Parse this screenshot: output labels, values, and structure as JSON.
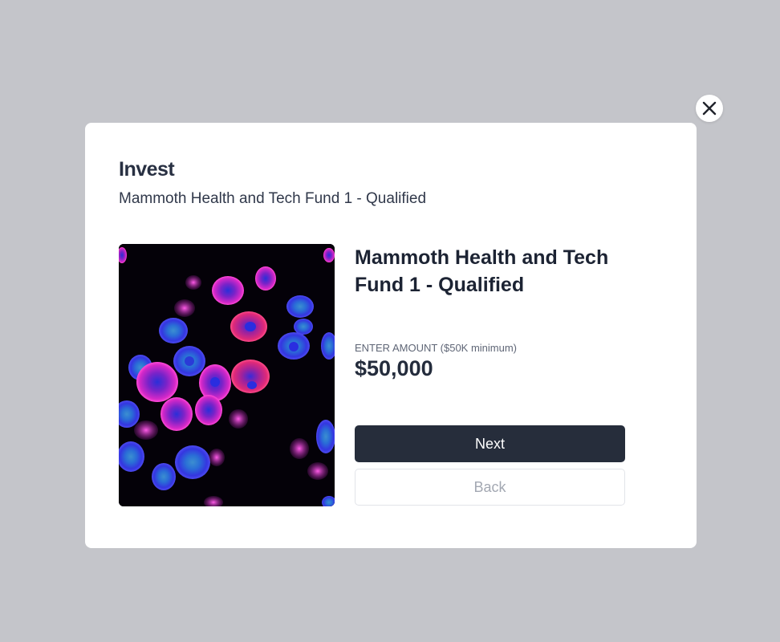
{
  "modal": {
    "title": "Invest",
    "subtitle": "Mammoth Health and Tech Fund 1 - Qualified",
    "close_icon": "close-icon"
  },
  "fund": {
    "name": "Mammoth Health and Tech Fund 1 - Qualified",
    "image": "fluorescent-cell-microscopy-image"
  },
  "amount": {
    "label": "ENTER AMOUNT ($50K minimum)",
    "value": "$50,000"
  },
  "buttons": {
    "next_label": "Next",
    "back_label": "Back"
  },
  "colors": {
    "overlay": "#c4c5ca",
    "primary_button": "#262d3b",
    "title_text": "#283042"
  }
}
